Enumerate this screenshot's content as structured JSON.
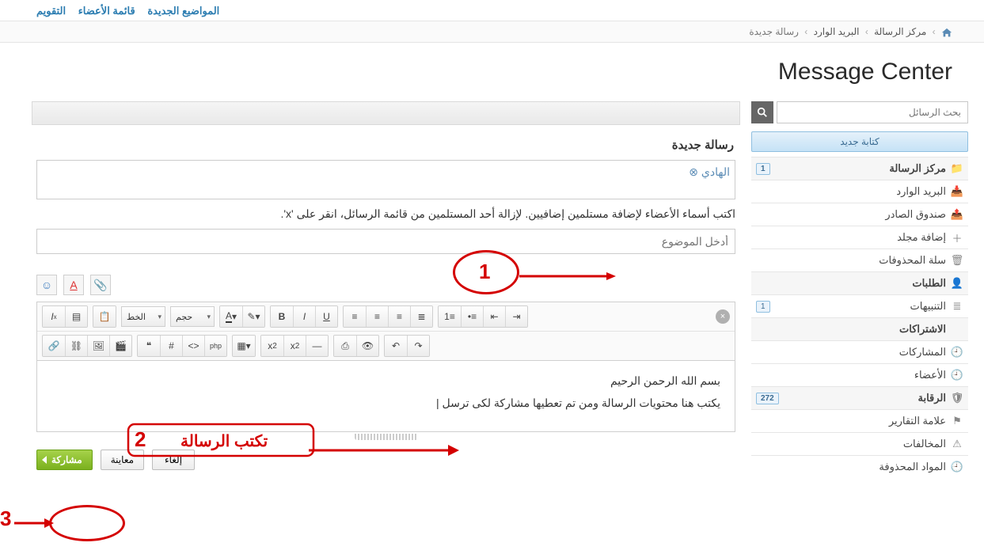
{
  "topnav": {
    "new_topics": "المواضيع الجديدة",
    "members_list": "قائمة الأعضاء",
    "calendar": "التقويم"
  },
  "breadcrumb": {
    "center": "مركز الرسالة",
    "inbox": "البريد الوارد",
    "new": "رسالة جديدة"
  },
  "page_title": "Message Center",
  "sidebar": {
    "search_placeholder": "بحث الرسائل",
    "compose_label": "كتابة جديد",
    "items": [
      {
        "label": "مركز الرسالة",
        "icon": "folder",
        "badge": "1",
        "section": true
      },
      {
        "label": "البريد الوارد",
        "icon": "inbox-in"
      },
      {
        "label": "صندوق الصادر",
        "icon": "inbox-out"
      },
      {
        "label": "إضافة مجلد",
        "icon": "plus"
      },
      {
        "label": "سلة المحذوفات",
        "icon": "trash"
      },
      {
        "label": "الطلبات",
        "icon": "user",
        "section": true
      },
      {
        "label": "التنبيهات",
        "icon": "list",
        "badge": "1"
      },
      {
        "label": "الاشتراكات",
        "icon": "",
        "section": true
      },
      {
        "label": "المشاركات",
        "icon": "clock"
      },
      {
        "label": "الأعضاء",
        "icon": "clock"
      },
      {
        "label": "الرقابة",
        "icon": "shield",
        "badge": "272",
        "section": true
      },
      {
        "label": "علامة التقارير",
        "icon": "flag"
      },
      {
        "label": "المخالفات",
        "icon": "warn"
      },
      {
        "label": "المواد المحذوفة",
        "icon": "clock"
      }
    ]
  },
  "form": {
    "title": "رسالة جديدة",
    "recipient_chip": "الهادي",
    "help": "اكتب أسماء الأعضاء لإضافة مستلمين إضافيين. لإزالة أحد المستلمين من قائمة الرسائل، انقر على 'x'.",
    "subject_placeholder": "أدخل الموضوع"
  },
  "editor": {
    "font_label": "الخط",
    "size_label": "حجم",
    "body_line1": "بسم الله الرحمن الرحيم",
    "body_line2": "يكتب هنا محتويات الرسالة  ومن تم تعطيها مشاركة لكى ترسل |"
  },
  "actions": {
    "share": "مشاركة",
    "preview": "معاينة",
    "cancel": "إلغاء"
  },
  "annotations": {
    "n1": "1",
    "n2": "2",
    "n3": "3",
    "write_msg": "تكتب الرسالة"
  }
}
